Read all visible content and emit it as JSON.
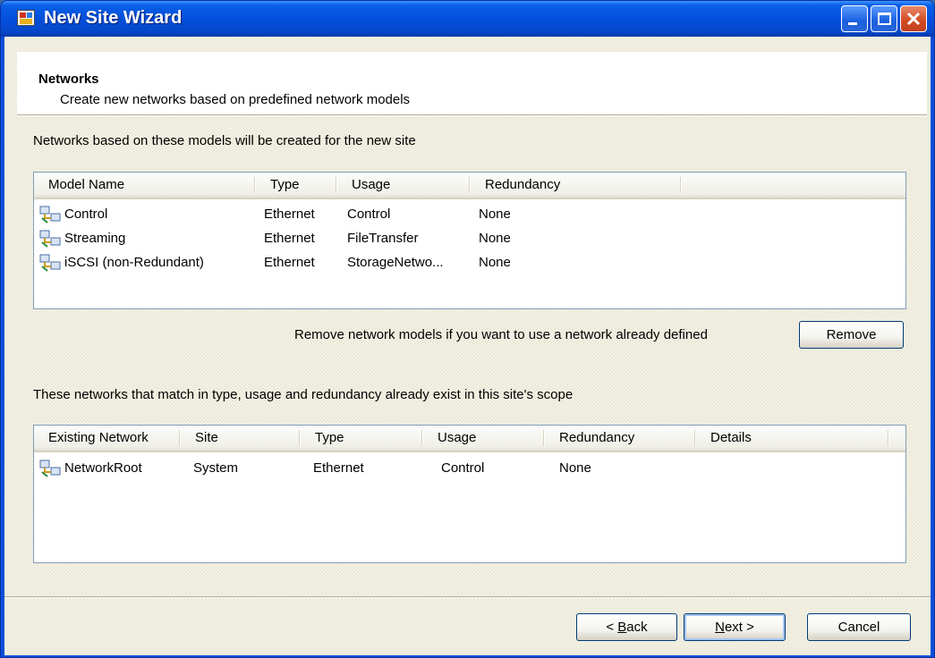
{
  "window": {
    "title": "New Site Wizard"
  },
  "header": {
    "title": "Networks",
    "subtitle": "Create new networks based on predefined network models"
  },
  "models_section": {
    "label": "Networks based on these models will be created for the new site",
    "columns": [
      "Model Name",
      "Type",
      "Usage",
      "Redundancy",
      ""
    ],
    "rows": [
      {
        "name": "Control",
        "type": "Ethernet",
        "usage": "Control",
        "redundancy": "None"
      },
      {
        "name": "Streaming",
        "type": "Ethernet",
        "usage": "FileTransfer",
        "redundancy": "None"
      },
      {
        "name": "iSCSI (non-Redundant)",
        "type": "Ethernet",
        "usage": "StorageNetwo...",
        "redundancy": "None"
      }
    ],
    "remove_hint": "Remove network models if you want to use a network already defined",
    "remove_label": "Remove"
  },
  "existing_section": {
    "label": "These networks that match in type, usage and redundancy already exist in this site's scope",
    "columns": [
      "Existing Network",
      "Site",
      "Type",
      "Usage",
      "Redundancy",
      "Details",
      ""
    ],
    "rows": [
      {
        "network": "NetworkRoot",
        "site": "System",
        "type": "Ethernet",
        "usage": "Control",
        "redundancy": "None",
        "details": ""
      }
    ]
  },
  "footer": {
    "back_prefix": "< ",
    "back_accel": "B",
    "back_rest": "ack",
    "next_accel": "N",
    "next_rest": "ext >",
    "cancel_label": "Cancel"
  },
  "colors": {
    "titlebar": "#0550dc",
    "face": "#ece9d8",
    "list_border": "#7f9db9",
    "close_button": "#d24a20"
  },
  "icons": {
    "app": "wizard-app-icon",
    "row": "network-icon",
    "minimize": "minimize-icon",
    "maximize": "maximize-icon",
    "close": "close-icon"
  }
}
